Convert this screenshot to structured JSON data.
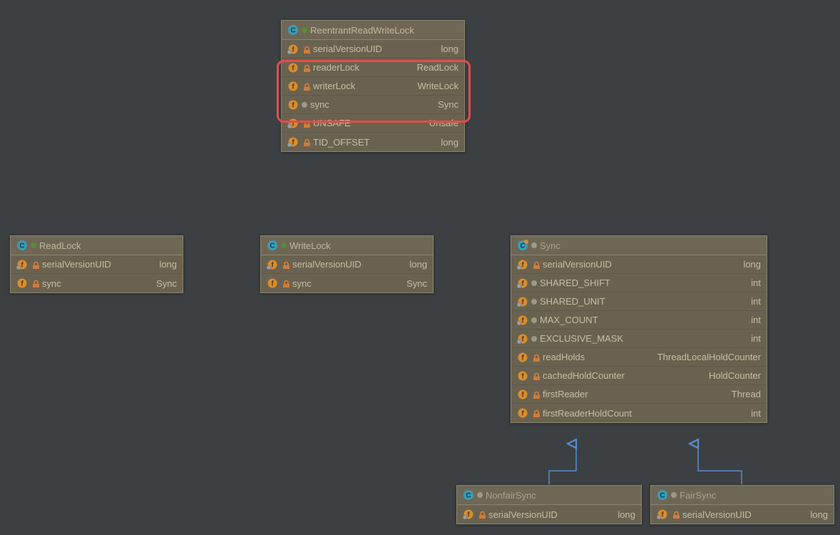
{
  "classes": {
    "reentrant": {
      "name": "ReentrantReadWriteLock",
      "fields": [
        {
          "name": "serialVersionUID",
          "type": "long",
          "mod": "lock",
          "icon": "field-static"
        },
        {
          "name": "readerLock",
          "type": "ReadLock",
          "mod": "lock",
          "icon": "field"
        },
        {
          "name": "writerLock",
          "type": "WriteLock",
          "mod": "lock",
          "icon": "field"
        },
        {
          "name": "sync",
          "type": "Sync",
          "mod": "gray",
          "icon": "field"
        },
        {
          "name": "UNSAFE",
          "type": "Unsafe",
          "mod": "lock",
          "icon": "field-static"
        },
        {
          "name": "TID_OFFSET",
          "type": "long",
          "mod": "lock",
          "icon": "field-static"
        }
      ]
    },
    "readlock": {
      "name": "ReadLock",
      "fields": [
        {
          "name": "serialVersionUID",
          "type": "long",
          "mod": "lock",
          "icon": "field-static"
        },
        {
          "name": "sync",
          "type": "Sync",
          "mod": "lock",
          "icon": "field"
        }
      ]
    },
    "writelock": {
      "name": "WriteLock",
      "fields": [
        {
          "name": "serialVersionUID",
          "type": "long",
          "mod": "lock",
          "icon": "field-static"
        },
        {
          "name": "sync",
          "type": "Sync",
          "mod": "lock",
          "icon": "field"
        }
      ]
    },
    "sync": {
      "name": "Sync",
      "fields": [
        {
          "name": "serialVersionUID",
          "type": "long",
          "mod": "lock",
          "icon": "field-static"
        },
        {
          "name": "SHARED_SHIFT",
          "type": "int",
          "mod": "gray",
          "icon": "field-static"
        },
        {
          "name": "SHARED_UNIT",
          "type": "int",
          "mod": "gray",
          "icon": "field-static"
        },
        {
          "name": "MAX_COUNT",
          "type": "int",
          "mod": "gray",
          "icon": "field-static"
        },
        {
          "name": "EXCLUSIVE_MASK",
          "type": "int",
          "mod": "gray",
          "icon": "field-static"
        },
        {
          "name": "readHolds",
          "type": "ThreadLocalHoldCounter",
          "mod": "lock",
          "icon": "field"
        },
        {
          "name": "cachedHoldCounter",
          "type": "HoldCounter",
          "mod": "lock",
          "icon": "field"
        },
        {
          "name": "firstReader",
          "type": "Thread",
          "mod": "lock",
          "icon": "field"
        },
        {
          "name": "firstReaderHoldCount",
          "type": "int",
          "mod": "lock",
          "icon": "field"
        }
      ]
    },
    "nonfairsync": {
      "name": "NonfairSync",
      "fields": [
        {
          "name": "serialVersionUID",
          "type": "long",
          "mod": "lock",
          "icon": "field-static"
        }
      ]
    },
    "fairsync": {
      "name": "FairSync",
      "fields": [
        {
          "name": "serialVersionUID",
          "type": "long",
          "mod": "lock",
          "icon": "field-static"
        }
      ]
    }
  },
  "colors": {
    "bg": "#3c4042",
    "box": "#6a6250",
    "highlight": "#e94a4a",
    "arrow": "#5a8ad0"
  }
}
